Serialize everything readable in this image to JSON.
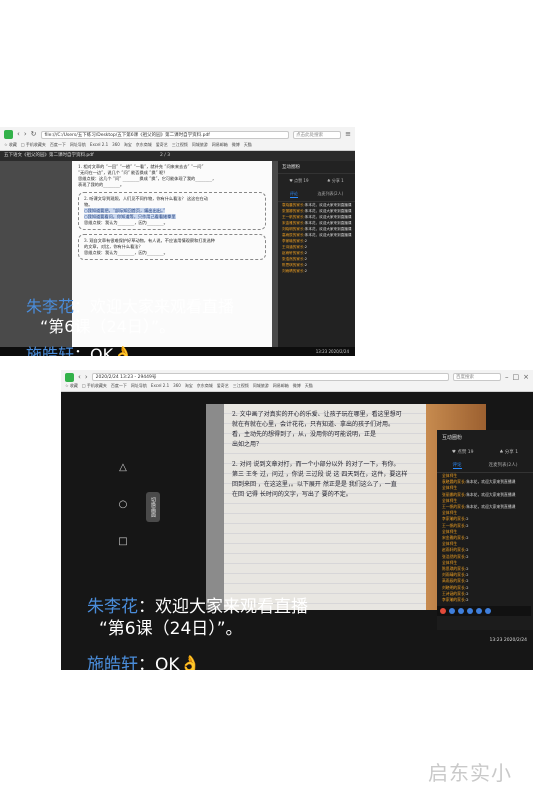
{
  "shot1": {
    "tab_title": "五下语文《祖父的园》第二课时自学资料.pdf",
    "address": "file:///C:/Users/五下练习/Desktop/五下第6课《祖父的园》第二课时自学资料.pdf",
    "search_placeholder": "点击此处搜索",
    "bookmarks": [
      "☆ 收藏",
      "□ 手机收藏夹",
      "百度一下",
      "网址导航",
      "Excel 2.1",
      "360",
      "淘宝",
      "京东商城",
      "爱奇艺",
      "三江视频",
      "同城旅游",
      "网易邮箱",
      "微博",
      "天猫"
    ],
    "pdf_toolbar": "五下语文《祖父的园》第二课时自学资料.pdf",
    "page_indicator": "2 / 3",
    "pdf_text": {
      "q1_line1": "1. 相对文章的 “一回” “一趟” “一看”，就补充 “问来来去去” “一问”",
      "q1_line2": "“无问在一边”，说几个 “问” 能否换成 “换” 呢？",
      "q1_line3": "思维点拨：这几个 “问” ________换成 “换”，它可能体现了我的________，",
      "q1_line4": "表现了我的的________。",
      "q2_line1": "2. 听课文导到观照，人们见不同作物，你有什么看法？ 这这在在动",
      "q2_line2": "物。",
      "q2_hl1": "○我知道要把，“部际知回首页，编出出出。”",
      "q2_hl2": "○我知道要看问，你知道等，只作用己看看她拳里",
      "q2_line3": "思维点拨：我认为________，因为________。",
      "q3_line1": "3. 观自文章有很难保护好草动物，有人说，不应该用情观察和打发选种",
      "q3_line2": "的文章，对比，你有什么看法？",
      "q3_line3": "思维点拨：我认为________，因为________。"
    },
    "panel": {
      "title": "互动圈粉",
      "stats": [
        "♥ 点赞 19",
        "♣ 分享 1"
      ],
      "tabs": [
        "评论",
        "连麦列表(2人)"
      ],
      "messages": [
        {
          "name": "袁晓晨的家长:",
          "text": "朱本花，欢迎大家来到直播课"
        },
        {
          "name": "张丽娜的家长:",
          "text": "朱本花，欢迎大家来到直播课"
        },
        {
          "name": "王一帆的家长:",
          "text": "朱本花，欢迎大家来到直播课"
        },
        {
          "name": "宋金雅的家长:",
          "text": "朱本花，欢迎大家来到直播课"
        },
        {
          "name": "刘晓明的家长:",
          "text": "朱本花，欢迎大家来到直播课"
        },
        {
          "name": "高雨辰的家长:",
          "text": "朱本花，欢迎大家来到直播课"
        },
        {
          "name": "李家瑜的家长:",
          "text": "2"
        },
        {
          "name": "王诗涵的家长:",
          "text": "2"
        },
        {
          "name": "赵雨轩的家长:",
          "text": "2"
        },
        {
          "name": "张浩然的家长:",
          "text": "2"
        },
        {
          "name": "陈思琪的家长:",
          "text": "2"
        },
        {
          "name": "刘雨晴的家长:",
          "text": "2"
        }
      ]
    },
    "taskbar_time": "13:23\n2020/2/24"
  },
  "shot2": {
    "address": "2020/2/24 13:23 - 29449号",
    "search_placeholder": "百度搜索",
    "video_text": {
      "l1": "2. 文中画了对真实的开心的乐爱、让孩子玩在哪里，看这里想可",
      "l2": "就在有就在心里，会计花花，只有知道、拿出的孩子们对用。",
      "l3": "看，主动先的想得到了，从，没用你的可能说明，正是",
      "l4": "出如之用？",
      "l5": "2. 对问 说到文章对打，而一个小部分以外 的对了一下，有你。",
      "l6": "第三 王冬 过，问过 ，你说 三过段 说 这 四天到在，这件，要这样",
      "l7": "回到来回 ，在这这里，。以下展开 然正是是 我们这么了，一直",
      "l8": "在回 记得 长时问的文字，写出了 要的不定。"
    },
    "switch_label": "切换画面",
    "panel": {
      "title": "互动圈粉",
      "stats": [
        "♥ 点赞 19",
        "♣ 分享 1"
      ],
      "tabs": [
        "评论",
        "连麦列表(2人)"
      ],
      "messages": [
        {
          "name": "全体师生",
          "text": ""
        },
        {
          "name": "袁晓晨的家长:",
          "text": "朱本花，欢迎大家来到直播课"
        },
        {
          "name": "全体师生",
          "text": ""
        },
        {
          "name": "张丽娜的家长:",
          "text": "朱本花，欢迎大家来到直播课"
        },
        {
          "name": "全体师生",
          "text": ""
        },
        {
          "name": "王一帆的家长:",
          "text": "朱本花，欢迎大家来到直播课"
        },
        {
          "name": "全体师生",
          "text": ""
        },
        {
          "name": "李家瑜的家长:",
          "text": "2"
        },
        {
          "name": "王一帆的家长:",
          "text": "2"
        },
        {
          "name": "全体师生",
          "text": ""
        },
        {
          "name": "宋金雅的家长:",
          "text": "2"
        },
        {
          "name": "全体师生",
          "text": ""
        },
        {
          "name": "赵雨轩的家长:",
          "text": "2"
        },
        {
          "name": "张浩然的家长:",
          "text": "2"
        },
        {
          "name": "全体师生",
          "text": ""
        },
        {
          "name": "陈思琪的家长:",
          "text": "2"
        },
        {
          "name": "刘雨晴的家长:",
          "text": "2"
        },
        {
          "name": "高雨辰的家长:",
          "text": "2"
        },
        {
          "name": "刘晓明的家长:",
          "text": "2"
        },
        {
          "name": "王诗涵的家长:",
          "text": "2"
        },
        {
          "name": "李家瑜的家长:",
          "text": "2"
        }
      ]
    },
    "clock": "13:23\n2020/2/24"
  },
  "overlay": {
    "name": "朱李花",
    "colon": "：",
    "line1": "欢迎大家来观看直播",
    "line2": "“第6课（24日）”。",
    "name2": "施皓轩",
    "colon2": "：",
    "text2": "OK👌"
  },
  "watermark": "启东实小"
}
